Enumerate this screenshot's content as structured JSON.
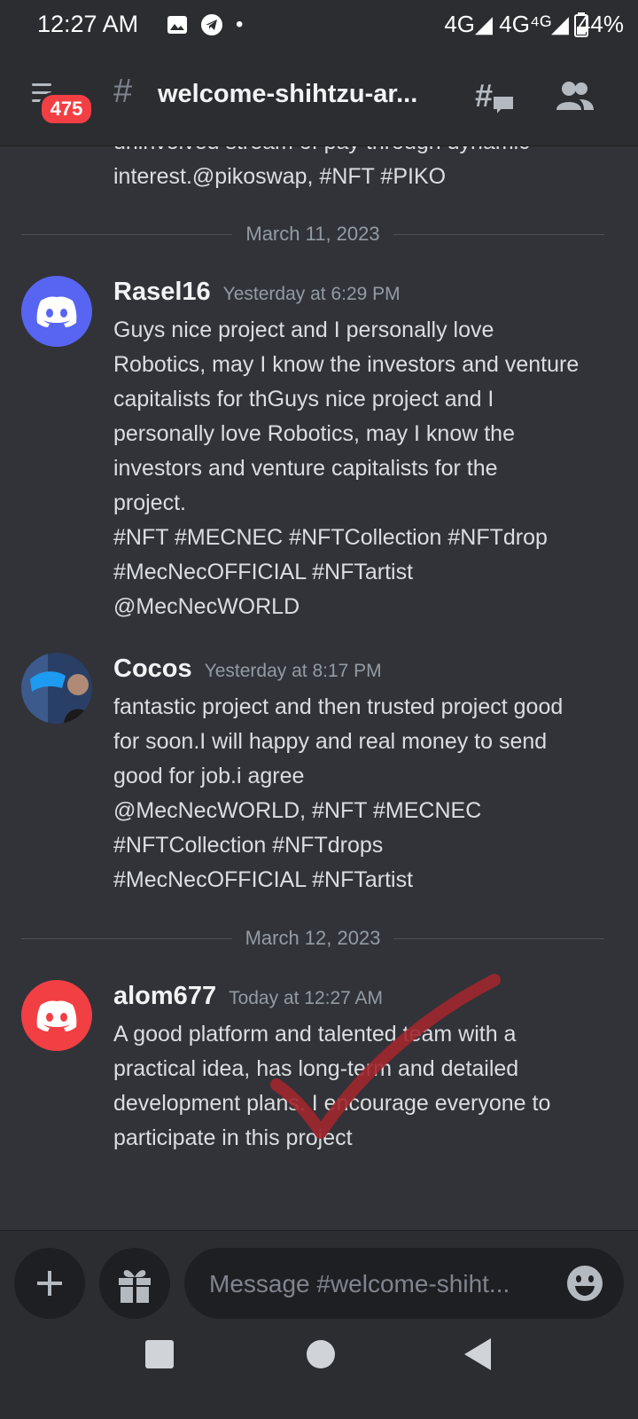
{
  "status_bar": {
    "time": "12:27 AM",
    "network": "4G◢ 4G⁴ᴳ◢",
    "battery": "44%"
  },
  "header": {
    "badge_count": "475",
    "channel_name": "welcome-shihtzu-ar..."
  },
  "messages": {
    "cut_off_text": [
      "uninvolved stream of pay through dynamic",
      "interest.@pikoswap, #NFT #PIKO"
    ],
    "divider_1": "March 11, 2023",
    "divider_2": "March 12, 2023",
    "items": [
      {
        "author": "Rasel16",
        "timestamp": "Yesterday at 6:29 PM",
        "avatar_color": "#5865f2",
        "lines": [
          "Guys nice project and I personally love",
          "Robotics, may I know the investors and venture",
          "capitalists for thGuys nice project and I",
          "personally love Robotics, may I know the",
          "investors and venture capitalists for the",
          "project.",
          "#NFT #MECNEC #NFTCollection #NFTdrop",
          "#MecNecOFFICIAL #NFTartist",
          "@MecNecWORLD"
        ]
      },
      {
        "author": "Cocos",
        "timestamp": "Yesterday at 8:17 PM",
        "lines": [
          "fantastic project and then trusted project good",
          "for soon.I will happy and real money to send",
          "good for job.i agree",
          "@MecNecWORLD, #NFT #MECNEC",
          "#NFTCollection #NFTdrops",
          "#MecNecOFFICIAL #NFTartist"
        ]
      },
      {
        "author": "alom677",
        "timestamp": "Today at 12:27 AM",
        "avatar_color": "#f23f43",
        "lines": [
          "A good platform and talented team with a",
          "practical idea, has long-term and detailed",
          "development plans. I encourage everyone to",
          "participate in this project"
        ]
      }
    ]
  },
  "composer": {
    "placeholder": "Message #welcome-shiht..."
  },
  "colors": {
    "background": "#313338",
    "header": "#2b2d31",
    "blurple": "#5865f2",
    "red": "#f23f43",
    "checkmark": "#a1262e"
  },
  "icons": [
    "image-icon",
    "telegram-icon",
    "menu-icon",
    "threads-icon",
    "members-icon",
    "plus-icon",
    "gift-icon",
    "emoji-icon",
    "discord-logo-icon",
    "checkmark-icon"
  ]
}
